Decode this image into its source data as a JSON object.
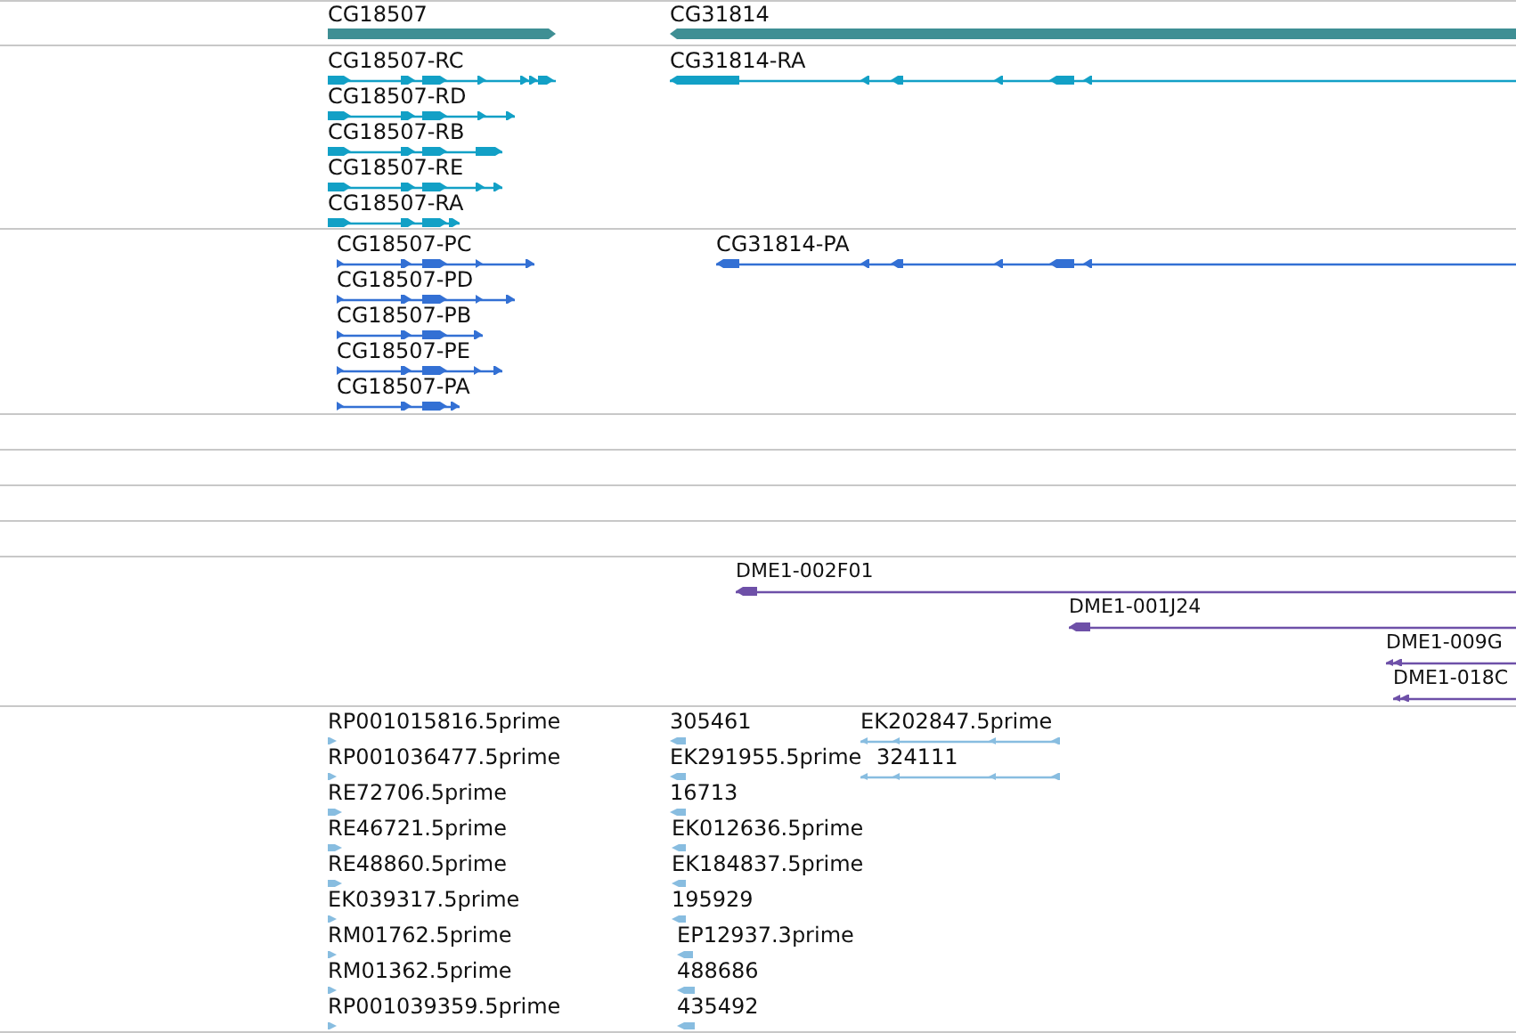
{
  "tracks": [
    {
      "kind": "gene",
      "color": "#3f8f94",
      "features": [
        {
          "label": "CG18507",
          "reverse": false
        },
        {
          "label": "CG31814",
          "reverse": true
        }
      ]
    },
    {
      "kind": "transcript",
      "color": "#12a0c6",
      "features": [
        {
          "label": "CG18507-RC",
          "reverse": false
        },
        {
          "label": "CG18507-RD",
          "reverse": false
        },
        {
          "label": "CG18507-RB",
          "reverse": false
        },
        {
          "label": "CG18507-RE",
          "reverse": false
        },
        {
          "label": "CG18507-RA",
          "reverse": false
        },
        {
          "label": "CG31814-RA",
          "reverse": true
        }
      ]
    },
    {
      "kind": "protein",
      "color": "#3370d4",
      "features": [
        {
          "label": "CG18507-PC",
          "reverse": false
        },
        {
          "label": "CG18507-PD",
          "reverse": false
        },
        {
          "label": "CG18507-PB",
          "reverse": false
        },
        {
          "label": "CG18507-PE",
          "reverse": false
        },
        {
          "label": "CG18507-PA",
          "reverse": false
        },
        {
          "label": "CG31814-PA",
          "reverse": true
        }
      ]
    },
    {
      "kind": "empty"
    },
    {
      "kind": "empty"
    },
    {
      "kind": "empty"
    },
    {
      "kind": "empty"
    },
    {
      "kind": "clone",
      "color": "#6e50a8",
      "features": [
        {
          "label": "DME1-002F01",
          "reverse": true
        },
        {
          "label": "DME1-001J24",
          "reverse": true
        },
        {
          "label": "DME1-009G",
          "reverse": true
        },
        {
          "label": "DME1-018C",
          "reverse": true
        }
      ]
    },
    {
      "kind": "est",
      "color": "#88bde0",
      "features": [
        {
          "label": "RP001015816.5prime",
          "reverse": false
        },
        {
          "label": "RP001036477.5prime",
          "reverse": false
        },
        {
          "label": "RE72706.5prime",
          "reverse": false
        },
        {
          "label": "RE46721.5prime",
          "reverse": false
        },
        {
          "label": "RE48860.5prime",
          "reverse": false
        },
        {
          "label": "EK039317.5prime",
          "reverse": false
        },
        {
          "label": "RM01762.5prime",
          "reverse": false
        },
        {
          "label": "RM01362.5prime",
          "reverse": false
        },
        {
          "label": "RP001039359.5prime",
          "reverse": false
        },
        {
          "label": "305461",
          "reverse": true
        },
        {
          "label": "EK291955.5prime",
          "reverse": true
        },
        {
          "label": "16713",
          "reverse": true
        },
        {
          "label": "EK012636.5prime",
          "reverse": true
        },
        {
          "label": "EK184837.5prime",
          "reverse": true
        },
        {
          "label": "195929",
          "reverse": true
        },
        {
          "label": "EP12937.3prime",
          "reverse": true
        },
        {
          "label": "488686",
          "reverse": true
        },
        {
          "label": "435492",
          "reverse": true
        },
        {
          "label": "EK202847.5prime",
          "reverse": true
        },
        {
          "label": "324111",
          "reverse": true
        }
      ]
    }
  ]
}
